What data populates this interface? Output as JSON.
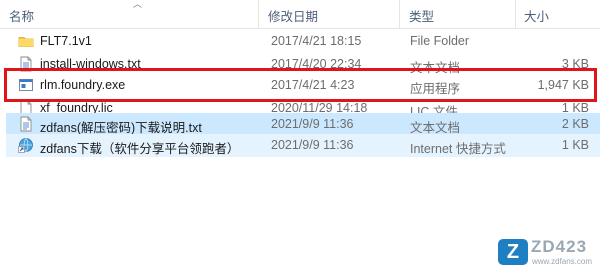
{
  "columns": {
    "name": "名称",
    "date": "修改日期",
    "type": "类型",
    "size": "大小"
  },
  "files": [
    {
      "icon": "folder-icon",
      "name": "FLT7.1v1",
      "date": "2017/4/21 18:15",
      "type": "File Folder",
      "size": "",
      "state": ""
    },
    {
      "icon": "text-file-icon",
      "name": "install-windows.txt",
      "date": "2017/4/20 22:34",
      "type": "文本文档",
      "size": "3 KB",
      "state": ""
    },
    {
      "icon": "exe-file-icon",
      "name": "rlm.foundry.exe",
      "date": "2017/4/21 4:23",
      "type": "应用程序",
      "size": "1,947 KB",
      "state": ""
    },
    {
      "icon": "lic-file-icon",
      "name": "xf_foundry.lic",
      "date": "2020/11/29 14:18",
      "type": "LIC 文件",
      "size": "1 KB",
      "state": ""
    },
    {
      "icon": "text-file-icon",
      "name": "zdfans(解压密码)下载说明.txt",
      "date": "2021/9/9 11:36",
      "type": "文本文档",
      "size": "2 KB",
      "state": "selected"
    },
    {
      "icon": "internet-shortcut-icon",
      "name": "zdfans下载（软件分享平台领跑者）",
      "date": "2021/9/9 11:36",
      "type": "Internet 快捷方式",
      "size": "1 KB",
      "state": "hover"
    }
  ],
  "watermark": {
    "badge": "Z",
    "text": "ZD423",
    "url": "www.zdfans.com"
  },
  "colors": {
    "highlight": "#e0141b",
    "selected_bg": "#cce8ff",
    "hover_bg": "#e5f3ff"
  }
}
